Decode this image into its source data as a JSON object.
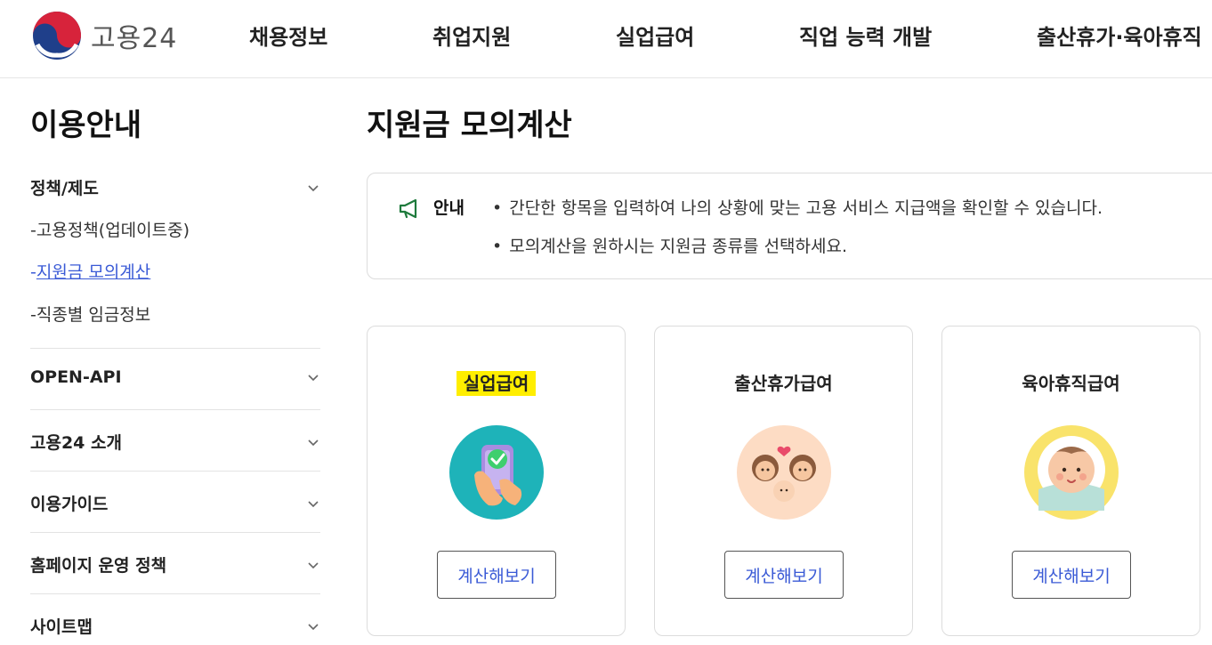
{
  "header": {
    "logo_text": "고용24",
    "nav": [
      "채용정보",
      "취업지원",
      "실업급여",
      "직업 능력 개발",
      "출산휴가·육아휴직"
    ]
  },
  "sidebar": {
    "title": "이용안내",
    "groups": [
      {
        "label": "정책/제도",
        "expanded": true,
        "items": [
          {
            "label": "고용정책(업데이트중)",
            "active": false
          },
          {
            "label": "지원금 모의계산",
            "active": true
          },
          {
            "label": "직종별 임금정보",
            "active": false
          }
        ]
      },
      {
        "label": "OPEN-API"
      },
      {
        "label": "고용24 소개"
      },
      {
        "label": "이용가이드"
      },
      {
        "label": "홈페이지 운영 정책"
      },
      {
        "label": "사이트맵"
      }
    ],
    "dash": "-"
  },
  "main": {
    "title": "지원금 모의계산",
    "notice": {
      "label": "안내",
      "bullet": "•",
      "lines": [
        "간단한 항목을 입력하여 나의 상황에 맞는 고용 서비스 지급액을 확인할 수 있습니다.",
        "모의계산을 원하시는 지원금 종류를 선택하세요."
      ]
    },
    "cards": [
      {
        "title": "실업급여",
        "button": "계산해보기",
        "icon": "phone-check-icon",
        "highlighted": true
      },
      {
        "title": "출산휴가급여",
        "button": "계산해보기",
        "icon": "family-icon",
        "highlighted": false
      },
      {
        "title": "육아휴직급여",
        "button": "계산해보기",
        "icon": "baby-icon",
        "highlighted": false
      }
    ]
  },
  "colors": {
    "accent": "#3a5ad6",
    "highlight": "#ffee00",
    "notice_icon": "#1e7a3c"
  }
}
